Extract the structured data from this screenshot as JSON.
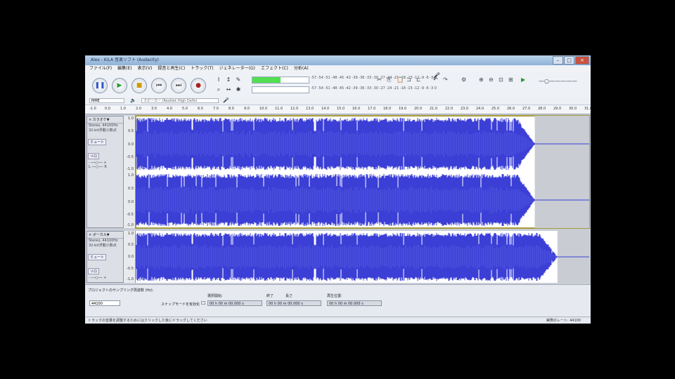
{
  "window": {
    "title": "Alex - KiLA 音楽ソフト (Audacity)"
  },
  "menu": {
    "items": [
      "ファイル(F)",
      "編集(E)",
      "表示(V)",
      "録音と再生(C)",
      "トラック(T)",
      "ジェネレーター(G)",
      "エフェクト(C)",
      "分析(A)"
    ]
  },
  "transport": {
    "pause_icon": "pause-icon",
    "play_icon": "play-icon",
    "record_icon": "record-icon",
    "stop_icon": "stop-icon",
    "skip_end_icon": "skip-end-icon",
    "skip_start_icon": "skip-start-icon"
  },
  "meter": {
    "scale_top": "-57 -54 -51 -48 -45 -42 -39 -36 -33 -30 -27 -24 -21 -18 -15 -12 -9 -6 -3 0",
    "scale_bottom": "-57 -54 -51 -48 -45 -42 -39 -36 -33 -30 -27 -24 -21 -18 -15 -12 -9 -6 -3 0",
    "level": 0.5
  },
  "device": {
    "host": "MME",
    "output": "スピーカー (Realtek High Defini"
  },
  "ruler": {
    "ticks": [
      "-1.0",
      "0.0",
      "1.0",
      "2.0",
      "3.0",
      "4.0",
      "5.0",
      "6.0",
      "7.0",
      "8.0",
      "9.0",
      "10.0",
      "11.0",
      "12.0",
      "13.0",
      "14.0",
      "15.0",
      "16.0",
      "17.0",
      "18.0",
      "19.0",
      "20.0",
      "21.0",
      "22.0",
      "23.0",
      "24.0",
      "25.0",
      "26.0",
      "27.0",
      "28.0",
      "29.0",
      "30.0",
      "31.0"
    ]
  },
  "tracks": [
    {
      "name": "× カラオケ▼",
      "info1": "Stereo, 44100Hz",
      "info2": "32-bit浮動小数点",
      "mute": "ミュート",
      "solo": "ソロ",
      "scale": [
        "1.0",
        "0.5",
        "0.0",
        "-0.5",
        "-1.0"
      ],
      "end_fraction": 0.88
    },
    {
      "name": "× ボーカル▼",
      "info1": "Stereo, 44100Hz",
      "info2": "32-bit浮動小数点",
      "mute": "ミュート",
      "solo": "ソロ",
      "scale": [
        "1.0",
        "0.5",
        "0.0",
        "-0.5",
        "-1.0"
      ],
      "end_fraction": 0.93
    }
  ],
  "selection": {
    "rate_label": "プロジェクトのサンプリング周波数 (Hz):",
    "rate_value": "44100",
    "snap_label": "スナップモードを有効化",
    "start_label": "選択開始:",
    "end_label": "終了",
    "length_label": "長さ",
    "audio_pos_label": "再生位置:",
    "start_value": "00 h 00 m 00.000 s",
    "end_value": "00 h 00 m 00.000 s",
    "audio_pos_value": "00 h 00 m 00.000 s"
  },
  "status": {
    "message": "トラックの音量を調整するためにはクリックした後にドラッグしてください",
    "rate": "実際のレート: 44100"
  },
  "colors": {
    "wave": "#3b3fd6",
    "wave_bg": "#ffffff",
    "selected_outline": "#a59b3a",
    "meter_fill": "#52e052"
  }
}
